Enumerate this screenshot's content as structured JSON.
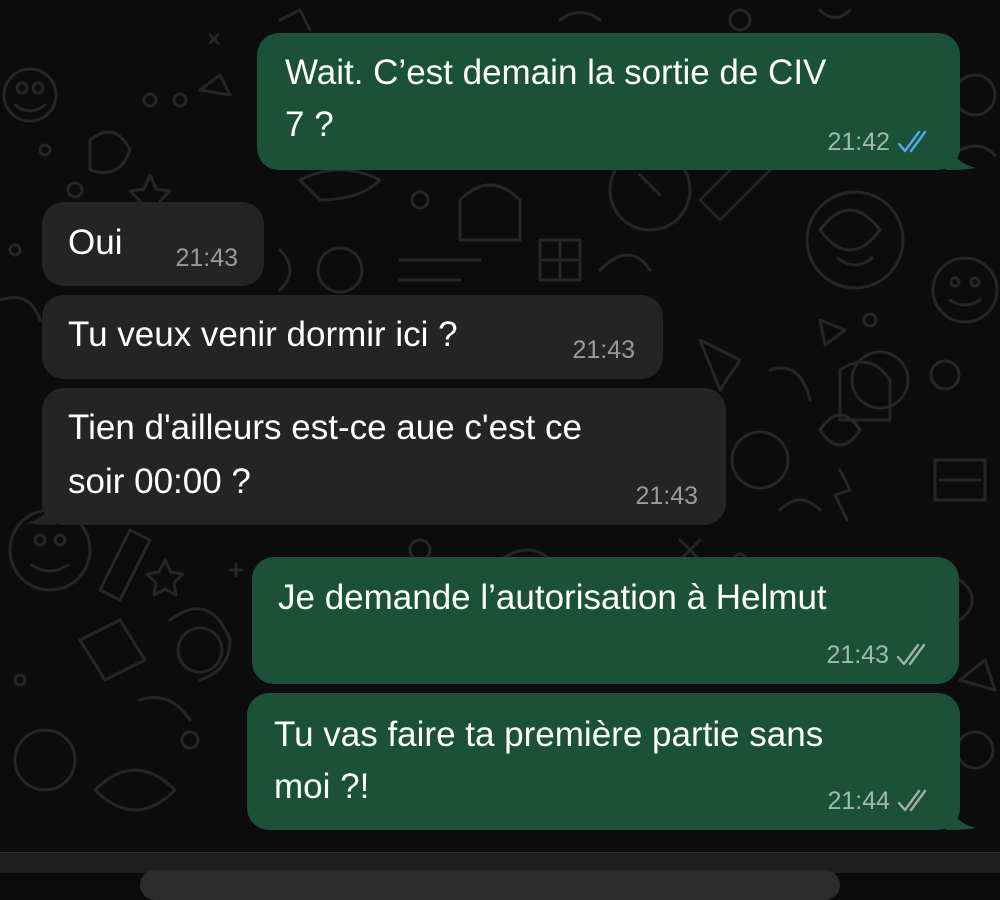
{
  "messages": [
    {
      "direction": "outgoing",
      "lines": [
        "Wait. C’est demain la sortie de CIV",
        "7 ?"
      ],
      "time": "21:42",
      "status": "read",
      "tick_color": "#58a6ef"
    },
    {
      "direction": "incoming",
      "lines": [
        "Oui"
      ],
      "time": "21:43"
    },
    {
      "direction": "incoming",
      "lines": [
        "Tu veux venir dormir ici ?"
      ],
      "time": "21:43"
    },
    {
      "direction": "incoming",
      "lines": [
        "Tien d'ailleurs est-ce aue c'est ce",
        "soir 00:00 ?"
      ],
      "time": "21:43"
    },
    {
      "direction": "outgoing",
      "lines": [
        "Je demande l’autorisation à Helmut"
      ],
      "time": "21:43",
      "status": "delivered",
      "tick_color": "#9fb1a7"
    },
    {
      "direction": "outgoing",
      "lines": [
        "Tu vas faire ta première partie sans",
        "moi ?!"
      ],
      "time": "21:44",
      "status": "delivered",
      "tick_color": "#9fb1a7"
    }
  ],
  "colors": {
    "outgoing_bubble": "#1c5139",
    "incoming_bubble": "#242424",
    "background": "#0c0c0c"
  },
  "icons": {
    "read_receipt": "double-check-icon",
    "delivered_receipt": "double-check-icon",
    "wallpaper": "doodle-pattern"
  }
}
